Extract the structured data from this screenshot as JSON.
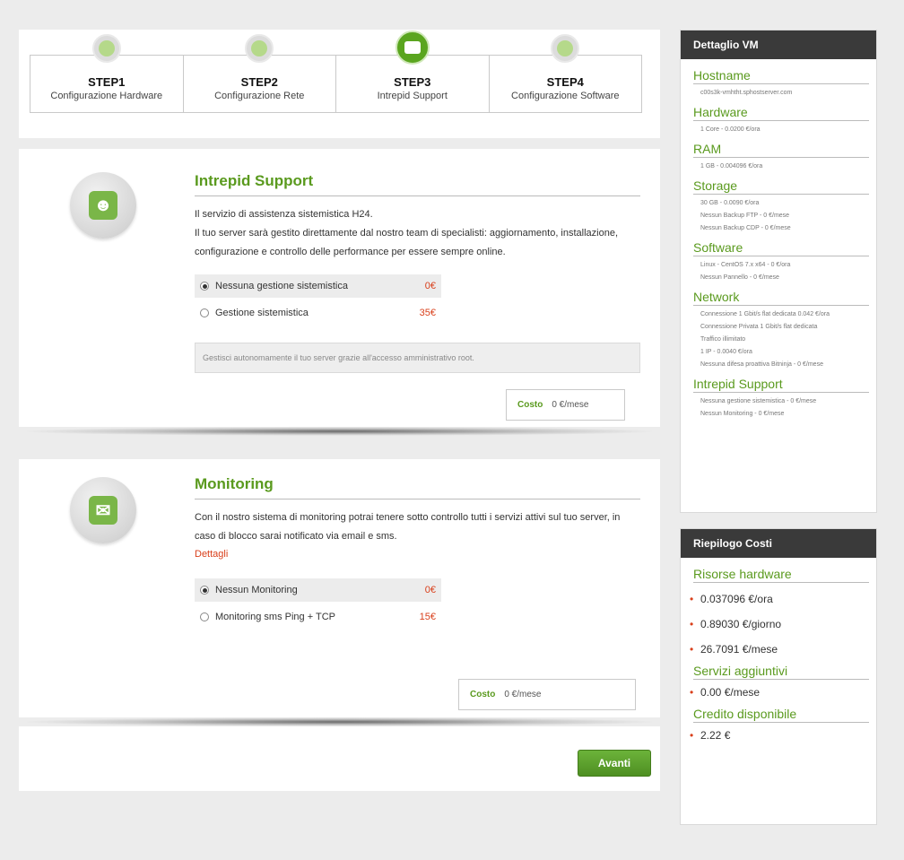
{
  "steps": [
    {
      "num": "STEP1",
      "label": "Configurazione Hardware",
      "icon": "chip-icon"
    },
    {
      "num": "STEP2",
      "label": "Configurazione Rete",
      "icon": "globe-icon"
    },
    {
      "num": "STEP3",
      "label": "Intrepid Support",
      "icon": "monitor-icon"
    },
    {
      "num": "STEP4",
      "label": "Configurazione Software",
      "icon": "gears-icon"
    }
  ],
  "support": {
    "title": "Intrepid Support",
    "line1": "Il servizio di assistenza sistemistica H24.",
    "line2": "Il tuo server sarà gestito direttamente dal nostro team di specialisti: aggiornamento, installazione, configurazione e controllo delle performance per essere sempre online.",
    "options": [
      {
        "label": "Nessuna gestione sistemistica",
        "price": "0€"
      },
      {
        "label": "Gestione sistemistica",
        "price": "35€"
      }
    ],
    "info": "Gestisci autonomamente il tuo server grazie all'accesso amministrativo root.",
    "cost_label": "Costo",
    "cost_value": "0  €/mese"
  },
  "monitoring": {
    "title": "Monitoring",
    "desc": "Con il nostro sistema di monitoring potrai tenere sotto controllo tutti i servizi attivi sul tuo server, in caso di blocco sarai notificato via email e sms.",
    "details_link": "Dettagli",
    "options": [
      {
        "label": "Nessun Monitoring",
        "price": "0€"
      },
      {
        "label": "Monitoring sms Ping + TCP",
        "price": "15€"
      }
    ],
    "cost_label": "Costo",
    "cost_value": "0  €/mese"
  },
  "next_button": "Avanti",
  "vm": {
    "title": "Dettaglio VM",
    "sections": [
      {
        "title": "Hostname",
        "items": [
          "c00s3k-vmhtht.sphostserver.com"
        ]
      },
      {
        "title": "Hardware",
        "items": [
          "1 Core - 0.0200 €/ora"
        ]
      },
      {
        "title": "RAM",
        "items": [
          "1 GB - 0.004096 €/ora"
        ]
      },
      {
        "title": "Storage",
        "items": [
          "30 GB - 0.0090 €/ora",
          "Nessun Backup FTP - 0 €/mese",
          "Nessun Backup CDP - 0 €/mese"
        ]
      },
      {
        "title": "Software",
        "items": [
          "Linux - CentOS 7.x x64 - 0 €/ora",
          "Nessun Pannello - 0 €/mese"
        ]
      },
      {
        "title": "Network",
        "items": [
          "Connessione 1 Gbit/s flat dedicata 0.042 €/ora",
          "Connessione Privata 1 Gbit/s flat dedicata",
          "Traffico illimitato",
          "1 IP - 0.0040 €/ora",
          "Nessuna difesa proattiva Bitninja - 0 €/mese"
        ]
      },
      {
        "title": "Intrepid Support",
        "items": [
          "Nessuna gestione sistemistica - 0 €/mese",
          "Nessun Monitoring - 0 €/mese"
        ]
      }
    ]
  },
  "costs": {
    "title": "Riepilogo Costi",
    "hardware_title": "Risorse hardware",
    "hardware": [
      "0.037096 €/ora",
      "0.89030 €/giorno",
      "26.7091 €/mese"
    ],
    "extra_title": "Servizi aggiuntivi",
    "extra": [
      "0.00 €/mese"
    ],
    "credit_title": "Credito disponibile",
    "credit": [
      "2.22 €"
    ]
  },
  "colors": {
    "accent_green": "#5a9a1e",
    "price_red": "#d9401c",
    "header_dark": "#3a3a3a"
  }
}
